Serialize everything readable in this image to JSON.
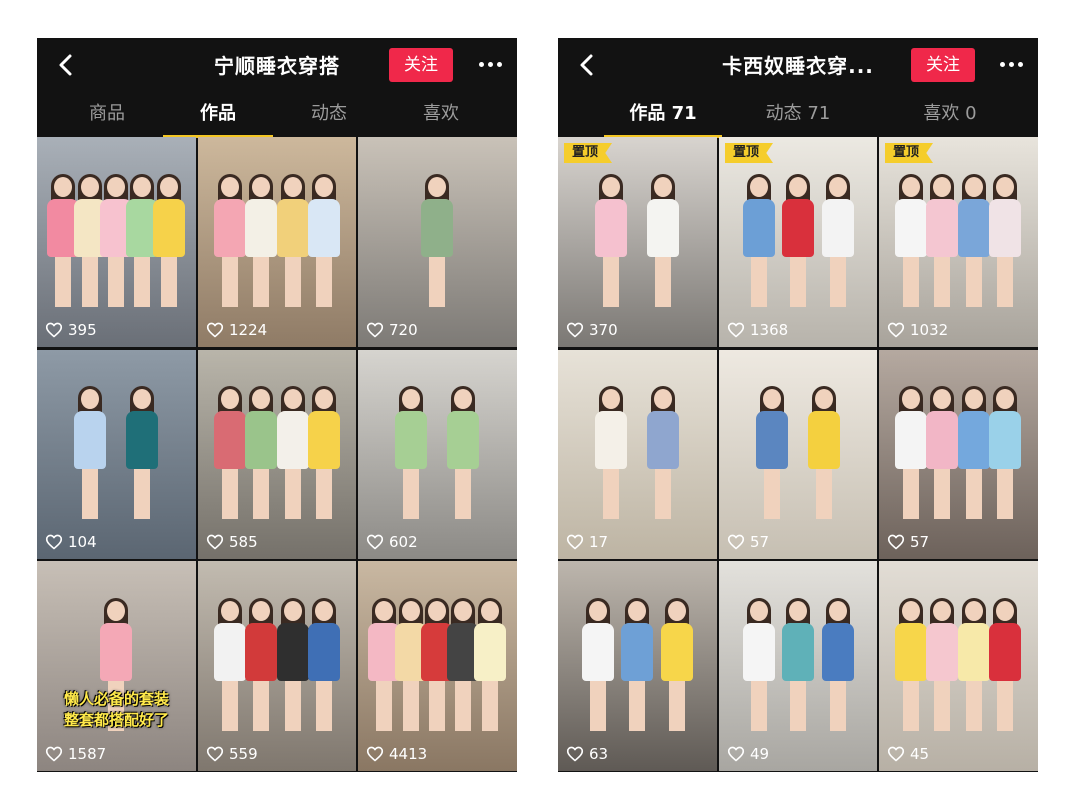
{
  "icons": {
    "back": "back-chevron-icon",
    "more": "more-dots-icon",
    "heart": "heart-icon"
  },
  "colors": {
    "follow_button": "#f0284a",
    "active_tab_underline": "#f3c623",
    "pin_badge": "#f5cd2b",
    "background": "#121212"
  },
  "left": {
    "title": "宁顺睡衣穿搭",
    "follow_label": "关注",
    "tabs": [
      {
        "label": "商品",
        "active": false
      },
      {
        "label": "作品",
        "active": true
      },
      {
        "label": "动态",
        "active": false
      },
      {
        "label": "喜欢",
        "active": false
      }
    ],
    "tiles": [
      {
        "likes": "395",
        "pinned": false,
        "bg": [
          "#a9b0b8",
          "#6a6f77"
        ],
        "people": [
          "#f28aa1",
          "#f4e6c4",
          "#f7c2cf",
          "#a8d8a0",
          "#f6d24a"
        ]
      },
      {
        "likes": "1224",
        "pinned": false,
        "bg": [
          "#cdb89c",
          "#8f7b66"
        ],
        "people": [
          "#f4a6b3",
          "#f3f0e6",
          "#f1d07a",
          "#d9e7f5"
        ]
      },
      {
        "likes": "720",
        "pinned": false,
        "bg": [
          "#c9c2b8",
          "#7d7a76"
        ],
        "people": [
          "#8fb08a"
        ]
      },
      {
        "likes": "104",
        "pinned": false,
        "bg": [
          "#8e9aa6",
          "#5b6672"
        ],
        "people": [
          "#b9d3ee",
          "#1f6f78"
        ]
      },
      {
        "likes": "585",
        "pinned": false,
        "bg": [
          "#b9b5aa",
          "#75716a"
        ],
        "people": [
          "#d96b73",
          "#9ac48b",
          "#f3f0ea",
          "#f6d24a"
        ]
      },
      {
        "likes": "602",
        "pinned": false,
        "bg": [
          "#d6d4cf",
          "#8c8a86"
        ],
        "people": [
          "#a6cf94",
          "#a6cf94"
        ]
      },
      {
        "likes": "1587",
        "pinned": false,
        "caption": [
          "懒人必备的套装",
          "整套都搭配好了"
        ],
        "bg": [
          "#c7bfb6",
          "#8d8580"
        ],
        "people": [
          "#f4a8b6"
        ]
      },
      {
        "likes": "559",
        "pinned": false,
        "bg": [
          "#c2bbb0",
          "#7f776e"
        ],
        "people": [
          "#f2f2f2",
          "#d23a3a",
          "#2f2f2f",
          "#3f6fb5"
        ]
      },
      {
        "likes": "4413",
        "pinned": false,
        "bg": [
          "#c9b8a2",
          "#8a7763"
        ],
        "people": [
          "#f4b8c4",
          "#f3d9a6",
          "#d63b3b",
          "#444444",
          "#f7f0c7"
        ]
      }
    ]
  },
  "right": {
    "title": "卡西奴睡衣穿...",
    "follow_label": "关注",
    "tabs": [
      {
        "label": "作品 71",
        "active": true
      },
      {
        "label": "动态 71",
        "active": false
      },
      {
        "label": "喜欢 0",
        "active": false
      }
    ],
    "tiles": [
      {
        "likes": "370",
        "pinned": true,
        "pin_label": "置顶",
        "bg": [
          "#d8d4cf",
          "#7b7874"
        ],
        "people": [
          "#f5c1cf",
          "#f4f4f1"
        ]
      },
      {
        "likes": "1368",
        "pinned": true,
        "pin_label": "置顶",
        "bg": [
          "#ece9e2",
          "#b7b3ab"
        ],
        "people": [
          "#6c9fd6",
          "#d9303c",
          "#f3f3f3"
        ]
      },
      {
        "likes": "1032",
        "pinned": true,
        "pin_label": "置顶",
        "bg": [
          "#e8e4dc",
          "#a8a39b"
        ],
        "people": [
          "#f5f5f5",
          "#f4c6d1",
          "#7aa6d9",
          "#f0e3e6"
        ]
      },
      {
        "likes": "17",
        "pinned": false,
        "bg": [
          "#e7e2d8",
          "#bdb4a3"
        ],
        "people": [
          "#f4f0e8",
          "#8fa6cf"
        ]
      },
      {
        "likes": "57",
        "pinned": false,
        "bg": [
          "#eee9e1",
          "#c6bfb2"
        ],
        "people": [
          "#5b86c0",
          "#f4d03f"
        ]
      },
      {
        "likes": "57",
        "pinned": false,
        "bg": [
          "#b5a9a0",
          "#6d625b"
        ],
        "people": [
          "#f4f4f4",
          "#f2b6c6",
          "#74a8dd",
          "#9ad1e9"
        ]
      },
      {
        "likes": "63",
        "pinned": false,
        "bg": [
          "#bdb6ad",
          "#5f5a55"
        ],
        "people": [
          "#f5f5f5",
          "#6ea0d6",
          "#f7d64a"
        ]
      },
      {
        "likes": "49",
        "pinned": false,
        "bg": [
          "#e3e1dc",
          "#a8a6a1"
        ],
        "people": [
          "#f5f5f5",
          "#5fb1b8",
          "#4a7cc0"
        ]
      },
      {
        "likes": "45",
        "pinned": false,
        "bg": [
          "#e2ddd5",
          "#b7b0a5"
        ],
        "people": [
          "#f7d64a",
          "#f5c7cf",
          "#f7e9a9",
          "#d9303c"
        ]
      }
    ]
  }
}
